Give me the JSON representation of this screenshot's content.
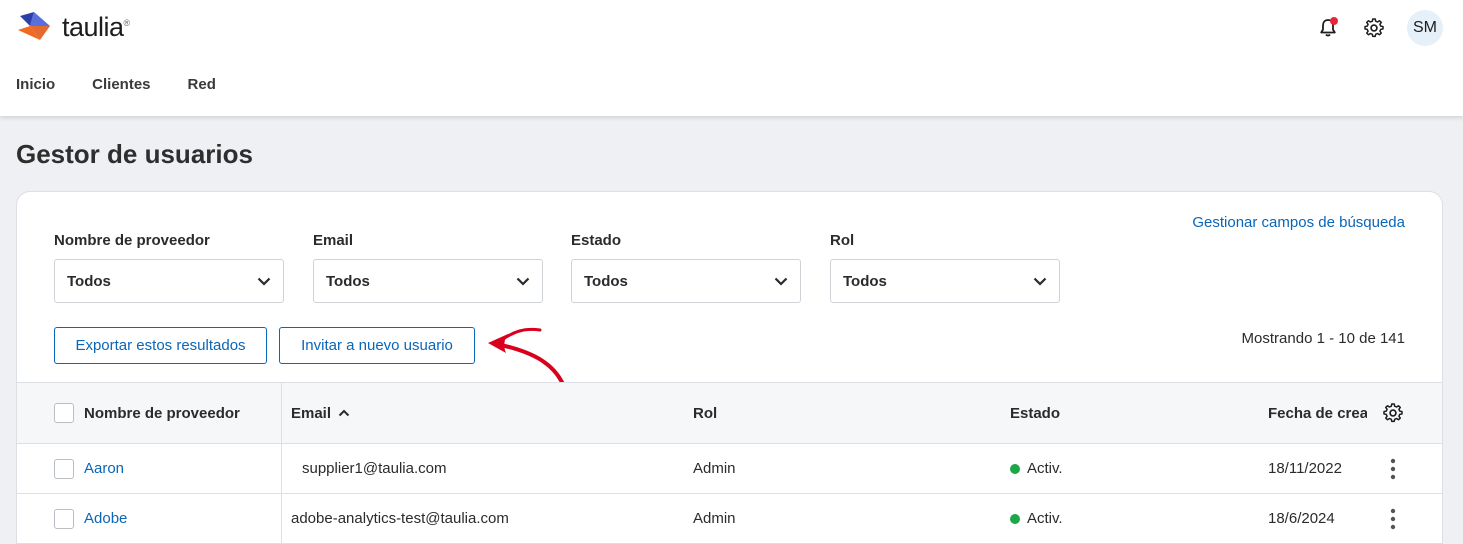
{
  "app": {
    "logo_text": "taulia",
    "logo_mark": "®"
  },
  "header": {
    "avatar_initials": "SM"
  },
  "nav": {
    "items": [
      "Inicio",
      "Clientes",
      "Red"
    ]
  },
  "page": {
    "title": "Gestor de usuarios"
  },
  "manage_link": "Gestionar campos de búsqueda",
  "filters": [
    {
      "label": "Nombre de proveedor",
      "value": "Todos"
    },
    {
      "label": "Email",
      "value": "Todos"
    },
    {
      "label": "Estado",
      "value": "Todos"
    },
    {
      "label": "Rol",
      "value": "Todos"
    }
  ],
  "actions": {
    "export_label": "Exportar estos resultados",
    "invite_label": "Invitar a nuevo usuario"
  },
  "pagination": {
    "showing_text": "Mostrando 1 - 10 de 141"
  },
  "table": {
    "columns": [
      "Nombre de proveedor",
      "Email",
      "Rol",
      "Estado",
      "Fecha de creación"
    ],
    "rows": [
      {
        "name": "Aaron",
        "email": "supplier1@taulia.com",
        "role": "Admin",
        "status": "Activ.",
        "date": "18/11/2022"
      },
      {
        "name": "Adobe",
        "email": "adobe-analytics-test@taulia.com",
        "role": "Admin",
        "status": "Activ.",
        "date": "18/6/2024"
      }
    ]
  },
  "colors": {
    "accent": "#0a66b8",
    "active_status": "#1ea64a",
    "notification": "#e5263d",
    "annotation_arrow": "#d9001b"
  }
}
